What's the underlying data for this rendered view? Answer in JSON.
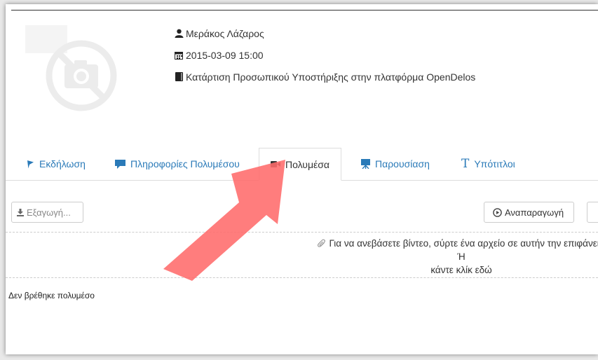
{
  "event": {
    "author": "Μεράκος Λάζαρος",
    "datetime": "2015-03-09  15:00",
    "title": "Κατάρτιση Προσωπικού Υποστήριξης στην πλατφόρμα OpenDelos"
  },
  "tabs": [
    {
      "label": "Εκδήλωση",
      "icon": "flag-icon"
    },
    {
      "label": "Πληροφορίες Πολυμέσου",
      "icon": "comment-icon"
    },
    {
      "label": "Πολυμέσα",
      "icon": "video-camera-icon",
      "active": true
    },
    {
      "label": "Παρουσίαση",
      "icon": "presentation-icon"
    },
    {
      "label": "Υπότιτλοι",
      "icon": "text-icon"
    }
  ],
  "toolbar": {
    "export_label": "Εξαγωγή...",
    "play_label": "Αναπαραγωγή"
  },
  "dropzone": {
    "line1": "Για να ανεβάσετε βίντεο, σύρτε ένα αρχείο σε αυτήν την επιφάνεια",
    "line2": "Ή",
    "line3": "κάντε κλίκ εδώ"
  },
  "empty_message": "Δεν βρέθηκε πολυμέσο",
  "colors": {
    "link": "#2a7ab8",
    "arrow": "#ff6b6b"
  }
}
